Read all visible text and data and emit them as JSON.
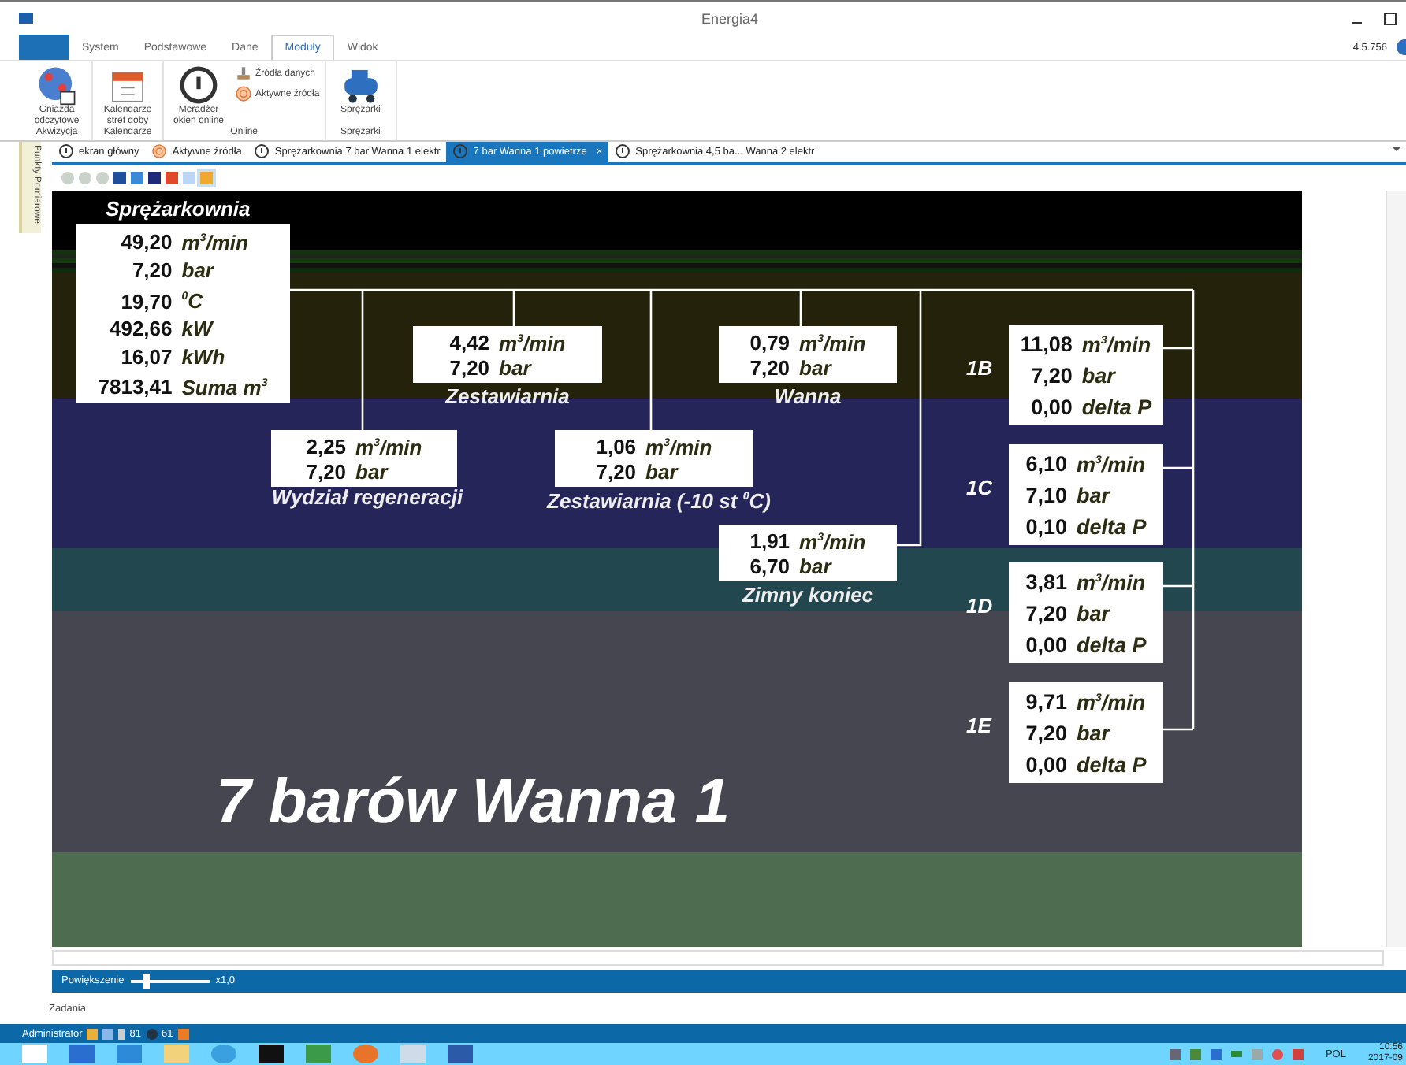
{
  "window": {
    "title": "Energia4",
    "version": "4.5.756"
  },
  "ribbon_tabs": [
    {
      "label": "System",
      "selected": false
    },
    {
      "label": "Podstawowe",
      "selected": false
    },
    {
      "label": "Dane",
      "selected": false
    },
    {
      "label": "Moduły",
      "selected": true
    },
    {
      "label": "Widok",
      "selected": false
    }
  ],
  "ribbon_groups": [
    {
      "label": "Akwizycja",
      "buttons": [
        {
          "kind": "large",
          "label": "Gniazda odczytowe"
        }
      ]
    },
    {
      "label": "Kalendarze",
      "buttons": [
        {
          "kind": "large",
          "label": "Kalendarze stref doby"
        }
      ]
    },
    {
      "label": "Online",
      "buttons": [
        {
          "kind": "large",
          "label": "Meradżer okien online"
        },
        {
          "kind": "small",
          "label": "Źródła danych"
        },
        {
          "kind": "small",
          "label": "Aktywne źródła"
        }
      ]
    },
    {
      "label": "Sprężarki",
      "buttons": [
        {
          "kind": "large",
          "label": "Sprężarki"
        }
      ]
    }
  ],
  "side_panel": {
    "label": "Punkty Pomiarowe"
  },
  "document_tabs": [
    {
      "label": "ekran główny",
      "selected": false
    },
    {
      "label": "Aktywne źródła",
      "selected": false
    },
    {
      "label": "Sprężarkownia 7 bar Wanna 1 elektr",
      "selected": false
    },
    {
      "label": "7 bar Wanna 1 powietrze",
      "selected": true,
      "close": "×"
    },
    {
      "label": "Sprężarkownia 4,5 ba... Wanna 2 elektr",
      "selected": false
    }
  ],
  "diagram": {
    "main": {
      "title": "Sprężarkownia",
      "rows": [
        {
          "value": "49,20",
          "unit": "m$^{3}$/min"
        },
        {
          "value": "7,20",
          "unit": "bar"
        },
        {
          "value": "19,70",
          "unit": "$^{0}$C"
        },
        {
          "value": "492,66",
          "unit": "kW"
        },
        {
          "value": "16,07",
          "unit": "kWh"
        },
        {
          "value": "7813,41",
          "unit": "Suma m$^{3}$"
        }
      ]
    },
    "branches": [
      {
        "label": "Zestawiarnia",
        "rows": [
          {
            "value": "4,42",
            "unit": "m$^{3}$/min"
          },
          {
            "value": "7,20",
            "unit": "bar"
          }
        ]
      },
      {
        "label": "Wanna",
        "rows": [
          {
            "value": "0,79",
            "unit": "m$^{3}$/min"
          },
          {
            "value": "7,20",
            "unit": "bar"
          }
        ]
      },
      {
        "label": "Wydział regeneracji",
        "rows": [
          {
            "value": "2,25",
            "unit": "m$^{3}$/min"
          },
          {
            "value": "7,20",
            "unit": "bar"
          }
        ]
      },
      {
        "label": "Zestawiarnia (-10 st $^{0}$C)",
        "rows": [
          {
            "value": "1,06",
            "unit": "m$^{3}$/min"
          },
          {
            "value": "7,20",
            "unit": "bar"
          }
        ]
      },
      {
        "label": "Zimny koniec",
        "rows": [
          {
            "value": "1,91",
            "unit": "m$^{3}$/min"
          },
          {
            "value": "6,70",
            "unit": "bar"
          }
        ]
      }
    ],
    "compressors": [
      {
        "label": "1B",
        "rows": [
          {
            "value": "11,08",
            "unit": "m$^{3}$/min"
          },
          {
            "value": "7,20",
            "unit": "bar"
          },
          {
            "value": "0,00",
            "unit": "delta P"
          }
        ]
      },
      {
        "label": "1C",
        "rows": [
          {
            "value": "6,10",
            "unit": "m$^{3}$/min"
          },
          {
            "value": "7,10",
            "unit": "bar"
          },
          {
            "value": "0,10",
            "unit": "delta P"
          }
        ]
      },
      {
        "label": "1D",
        "rows": [
          {
            "value": "3,81",
            "unit": "m$^{3}$/min"
          },
          {
            "value": "7,20",
            "unit": "bar"
          },
          {
            "value": "0,00",
            "unit": "delta P"
          }
        ]
      },
      {
        "label": "1E",
        "rows": [
          {
            "value": "9,71",
            "unit": "m$^{3}$/min"
          },
          {
            "value": "7,20",
            "unit": "bar"
          },
          {
            "value": "0,00",
            "unit": "delta P"
          }
        ]
      }
    ],
    "caption": "7 barów Wanna 1"
  },
  "status_bar": {
    "zoom_label": "Powiększenie",
    "zoom": {
      "level": 0.2
    },
    "zoom_value": "x1,0"
  },
  "tasks_label": "Zadania",
  "user_bar": {
    "user": "Administrator",
    "count_1": "81",
    "count_2": "61"
  },
  "tray": {
    "language": "POL",
    "time": "10:56",
    "date": "2017-09"
  }
}
